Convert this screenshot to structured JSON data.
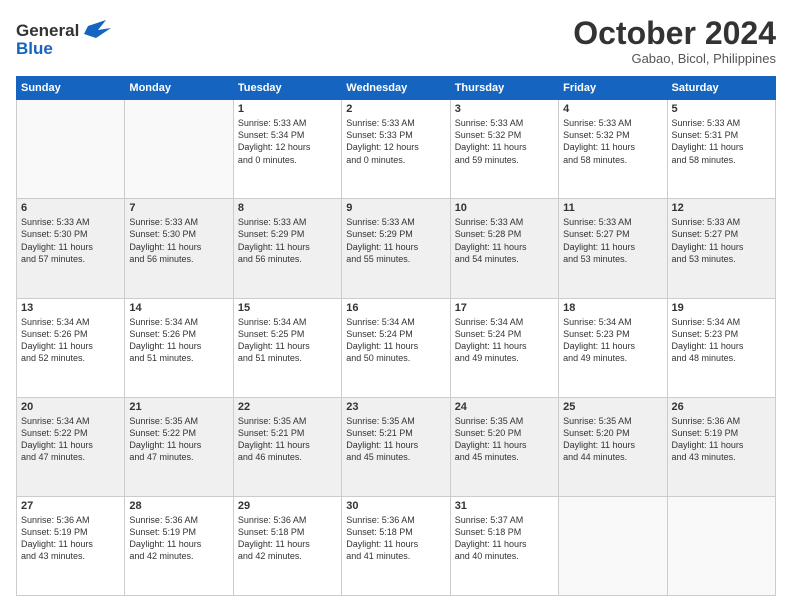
{
  "logo": {
    "line1": "General",
    "line2": "Blue"
  },
  "title": "October 2024",
  "subtitle": "Gabao, Bicol, Philippines",
  "headers": [
    "Sunday",
    "Monday",
    "Tuesday",
    "Wednesday",
    "Thursday",
    "Friday",
    "Saturday"
  ],
  "weeks": [
    [
      {
        "day": "",
        "text": ""
      },
      {
        "day": "",
        "text": ""
      },
      {
        "day": "1",
        "text": "Sunrise: 5:33 AM\nSunset: 5:34 PM\nDaylight: 12 hours\nand 0 minutes."
      },
      {
        "day": "2",
        "text": "Sunrise: 5:33 AM\nSunset: 5:33 PM\nDaylight: 12 hours\nand 0 minutes."
      },
      {
        "day": "3",
        "text": "Sunrise: 5:33 AM\nSunset: 5:32 PM\nDaylight: 11 hours\nand 59 minutes."
      },
      {
        "day": "4",
        "text": "Sunrise: 5:33 AM\nSunset: 5:32 PM\nDaylight: 11 hours\nand 58 minutes."
      },
      {
        "day": "5",
        "text": "Sunrise: 5:33 AM\nSunset: 5:31 PM\nDaylight: 11 hours\nand 58 minutes."
      }
    ],
    [
      {
        "day": "6",
        "text": "Sunrise: 5:33 AM\nSunset: 5:30 PM\nDaylight: 11 hours\nand 57 minutes."
      },
      {
        "day": "7",
        "text": "Sunrise: 5:33 AM\nSunset: 5:30 PM\nDaylight: 11 hours\nand 56 minutes."
      },
      {
        "day": "8",
        "text": "Sunrise: 5:33 AM\nSunset: 5:29 PM\nDaylight: 11 hours\nand 56 minutes."
      },
      {
        "day": "9",
        "text": "Sunrise: 5:33 AM\nSunset: 5:29 PM\nDaylight: 11 hours\nand 55 minutes."
      },
      {
        "day": "10",
        "text": "Sunrise: 5:33 AM\nSunset: 5:28 PM\nDaylight: 11 hours\nand 54 minutes."
      },
      {
        "day": "11",
        "text": "Sunrise: 5:33 AM\nSunset: 5:27 PM\nDaylight: 11 hours\nand 53 minutes."
      },
      {
        "day": "12",
        "text": "Sunrise: 5:33 AM\nSunset: 5:27 PM\nDaylight: 11 hours\nand 53 minutes."
      }
    ],
    [
      {
        "day": "13",
        "text": "Sunrise: 5:34 AM\nSunset: 5:26 PM\nDaylight: 11 hours\nand 52 minutes."
      },
      {
        "day": "14",
        "text": "Sunrise: 5:34 AM\nSunset: 5:26 PM\nDaylight: 11 hours\nand 51 minutes."
      },
      {
        "day": "15",
        "text": "Sunrise: 5:34 AM\nSunset: 5:25 PM\nDaylight: 11 hours\nand 51 minutes."
      },
      {
        "day": "16",
        "text": "Sunrise: 5:34 AM\nSunset: 5:24 PM\nDaylight: 11 hours\nand 50 minutes."
      },
      {
        "day": "17",
        "text": "Sunrise: 5:34 AM\nSunset: 5:24 PM\nDaylight: 11 hours\nand 49 minutes."
      },
      {
        "day": "18",
        "text": "Sunrise: 5:34 AM\nSunset: 5:23 PM\nDaylight: 11 hours\nand 49 minutes."
      },
      {
        "day": "19",
        "text": "Sunrise: 5:34 AM\nSunset: 5:23 PM\nDaylight: 11 hours\nand 48 minutes."
      }
    ],
    [
      {
        "day": "20",
        "text": "Sunrise: 5:34 AM\nSunset: 5:22 PM\nDaylight: 11 hours\nand 47 minutes."
      },
      {
        "day": "21",
        "text": "Sunrise: 5:35 AM\nSunset: 5:22 PM\nDaylight: 11 hours\nand 47 minutes."
      },
      {
        "day": "22",
        "text": "Sunrise: 5:35 AM\nSunset: 5:21 PM\nDaylight: 11 hours\nand 46 minutes."
      },
      {
        "day": "23",
        "text": "Sunrise: 5:35 AM\nSunset: 5:21 PM\nDaylight: 11 hours\nand 45 minutes."
      },
      {
        "day": "24",
        "text": "Sunrise: 5:35 AM\nSunset: 5:20 PM\nDaylight: 11 hours\nand 45 minutes."
      },
      {
        "day": "25",
        "text": "Sunrise: 5:35 AM\nSunset: 5:20 PM\nDaylight: 11 hours\nand 44 minutes."
      },
      {
        "day": "26",
        "text": "Sunrise: 5:36 AM\nSunset: 5:19 PM\nDaylight: 11 hours\nand 43 minutes."
      }
    ],
    [
      {
        "day": "27",
        "text": "Sunrise: 5:36 AM\nSunset: 5:19 PM\nDaylight: 11 hours\nand 43 minutes."
      },
      {
        "day": "28",
        "text": "Sunrise: 5:36 AM\nSunset: 5:19 PM\nDaylight: 11 hours\nand 42 minutes."
      },
      {
        "day": "29",
        "text": "Sunrise: 5:36 AM\nSunset: 5:18 PM\nDaylight: 11 hours\nand 42 minutes."
      },
      {
        "day": "30",
        "text": "Sunrise: 5:36 AM\nSunset: 5:18 PM\nDaylight: 11 hours\nand 41 minutes."
      },
      {
        "day": "31",
        "text": "Sunrise: 5:37 AM\nSunset: 5:18 PM\nDaylight: 11 hours\nand 40 minutes."
      },
      {
        "day": "",
        "text": ""
      },
      {
        "day": "",
        "text": ""
      }
    ]
  ]
}
